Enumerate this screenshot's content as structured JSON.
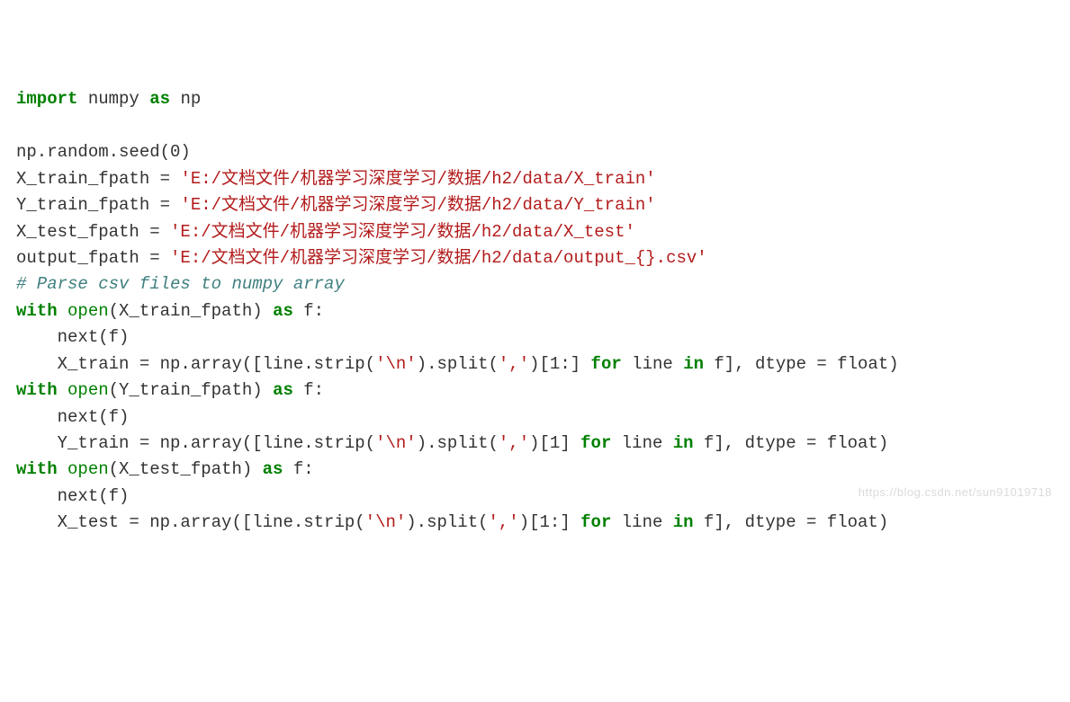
{
  "c": {
    "import": "import",
    "numpy": "numpy",
    "as": "as",
    "np": "np",
    "blank": " ",
    "seed": "np.random.seed(0)",
    "xtr_l": "X_train_fpath = ",
    "xtr_s": "'E:/文档文件/机器学习深度学习/数据/h2/data/X_train'",
    "ytr_l": "Y_train_fpath = ",
    "ytr_s": "'E:/文档文件/机器学习深度学习/数据/h2/data/Y_train'",
    "xte_l": "X_test_fpath = ",
    "xte_s": "'E:/文档文件/机器学习深度学习/数据/h2/data/X_test'",
    "out_l": "output_fpath = ",
    "out_s": "'E:/文档文件/机器学习深度学习/数据/h2/data/output_{}.csv'",
    "comment": "# Parse csv files to numpy array",
    "with": "with",
    "open": "open",
    "for": "for",
    "in": "in",
    "open_xtr": "(X_train_fpath) ",
    "open_ytr": "(Y_train_fpath) ",
    "open_xte": "(X_test_fpath) ",
    "f_colon": " f:",
    "next": "    next(f)",
    "xtr_arr1": "    X_train = np.array([line.strip(",
    "ytr_arr1": "    Y_train = np.array([line.strip(",
    "xte_arr1": "    X_test = np.array([line.strip(",
    "nl": "'\\n'",
    "split": ").split(",
    "comma": "','",
    "idx_all": ")[1:] ",
    "idx_one": ")[1] ",
    "line_mid": " line ",
    "tail": " f], dtype = float)"
  },
  "watermark": "https://blog.csdn.net/sun91019718"
}
